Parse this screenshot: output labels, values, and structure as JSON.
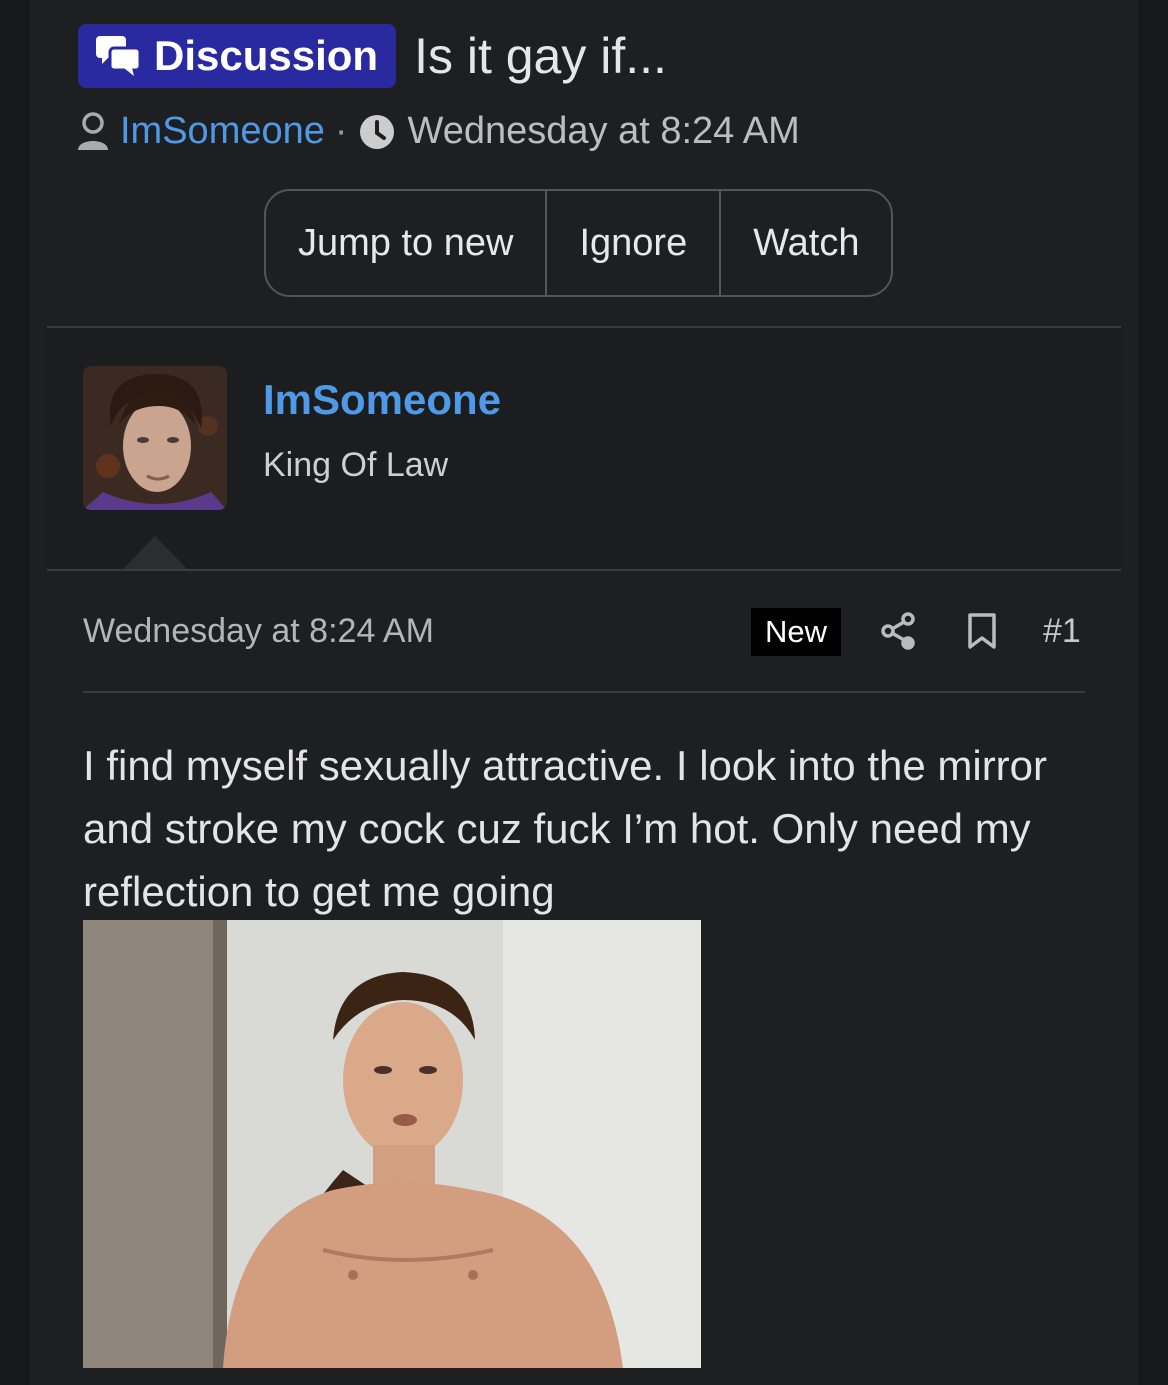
{
  "thread": {
    "prefix_label": "Discussion",
    "title": "Is it gay if...",
    "author": "ImSomeone",
    "meta_separator": "·",
    "date": "Wednesday at 8:24 AM"
  },
  "actions": {
    "jump_to_new": "Jump to new",
    "ignore": "Ignore",
    "watch": "Watch"
  },
  "post": {
    "username": "ImSomeone",
    "user_title": "King Of Law",
    "date": "Wednesday at 8:24 AM",
    "new_badge": "New",
    "number": "#1",
    "body": "I find myself sexually attractive. I look into the mirror and stroke my cock cuz fuck I’m hot. Only need my reflection to get me going"
  },
  "colors": {
    "background": "#1e1f21",
    "prefix_bg": "#2a2aa0",
    "link": "#4f9ae8",
    "badge_bg": "#000000"
  },
  "icons": {
    "prefix": "discussion-bubbles-icon",
    "author": "user-icon",
    "date": "clock-icon",
    "share": "share-icon",
    "bookmark": "bookmark-icon"
  }
}
